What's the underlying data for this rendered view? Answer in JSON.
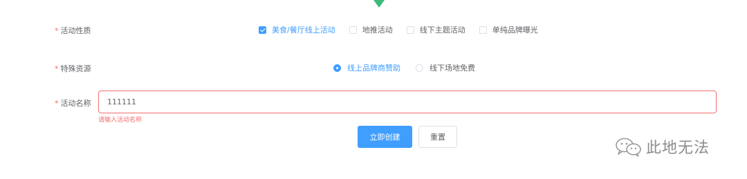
{
  "form": {
    "activity_type": {
      "label": "活动性质",
      "required_mark": "*",
      "options": [
        {
          "label": "美食/餐厅线上活动",
          "checked": true
        },
        {
          "label": "地推活动",
          "checked": false
        },
        {
          "label": "线下主题活动",
          "checked": false
        },
        {
          "label": "单纯品牌曝光",
          "checked": false
        }
      ]
    },
    "resource": {
      "label": "特殊资源",
      "required_mark": "*",
      "options": [
        {
          "label": "线上品牌商赞助",
          "checked": true
        },
        {
          "label": "线下场地免费",
          "checked": false
        }
      ]
    },
    "name": {
      "label": "活动名称",
      "required_mark": "*",
      "value": "111111",
      "error": "请输入活动名称"
    },
    "buttons": {
      "create": "立即创建",
      "reset": "重置"
    }
  },
  "watermark": {
    "text": "此地无法",
    "icon": "wechat-icon"
  },
  "colors": {
    "primary": "#409eff",
    "error": "#f56c6c",
    "caret": "#3cba7a"
  }
}
